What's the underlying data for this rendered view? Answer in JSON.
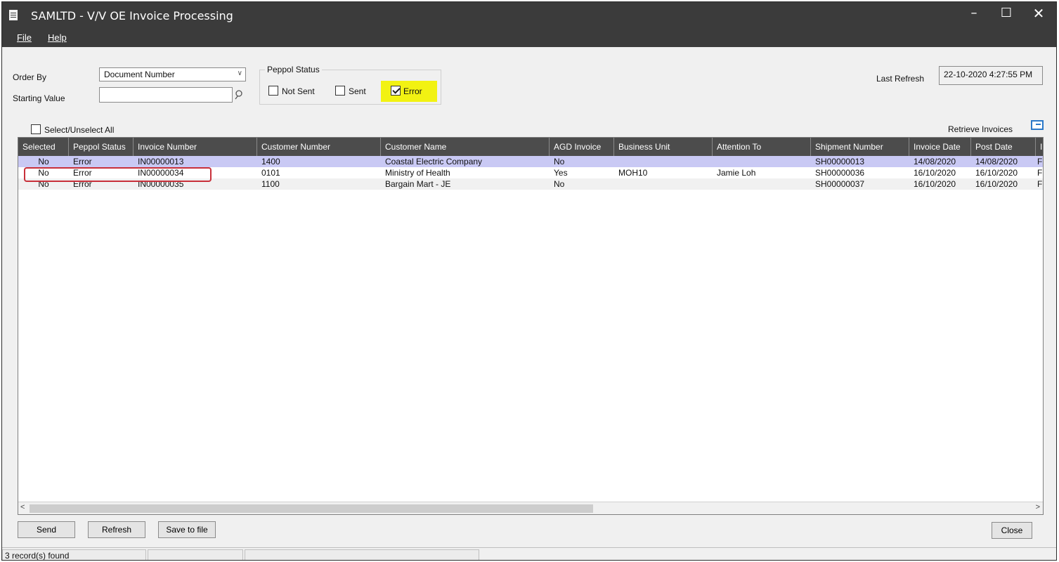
{
  "window": {
    "title": "SAMLTD - V/V OE Invoice Processing",
    "min_glyph": "–",
    "max_glyph": "☐",
    "close_glyph": "✕"
  },
  "menu": {
    "file": "File",
    "help": "Help"
  },
  "filters": {
    "order_by_label": "Order By",
    "order_by_value": "Document Number",
    "starting_value_label": "Starting Value",
    "starting_value": "",
    "peppol_status_title": "Peppol Status",
    "not_sent_label": "Not Sent",
    "not_sent_checked": false,
    "sent_label": "Sent",
    "sent_checked": false,
    "error_label": "Error",
    "error_checked": true,
    "highlight_color": "#f2f212"
  },
  "refresh": {
    "label": "Last Refresh",
    "value": "22-10-2020 4:27:55 PM"
  },
  "select_all_label": "Select/Unselect All",
  "retrieve_label": "Retrieve Invoices",
  "table": {
    "columns": [
      "Selected",
      "Peppol Status",
      "Invoice Number",
      "Customer Number",
      "Customer Name",
      "AGD Invoice",
      "Business Unit",
      "Attention To",
      "Shipment Number",
      "Invoice Date",
      "Post Date",
      "I"
    ],
    "rows": [
      [
        "No",
        "Error",
        "IN00000013",
        "1400",
        "Coastal Electric Company",
        "No",
        "",
        "",
        "SH00000013",
        "14/08/2020",
        "14/08/2020",
        "F"
      ],
      [
        "No",
        "Error",
        "IN00000034",
        "0101",
        "Ministry of Health",
        "Yes",
        "MOH10",
        "Jamie Loh",
        "SH00000036",
        "16/10/2020",
        "16/10/2020",
        "F"
      ],
      [
        "No",
        "Error",
        "IN00000035",
        "1100",
        "Bargain Mart - JE",
        "No",
        "",
        "",
        "SH00000037",
        "16/10/2020",
        "16/10/2020",
        "F"
      ]
    ],
    "selected_row_color": "#c9c9f4",
    "header_color": "#4c4c4c"
  },
  "buttons": {
    "send": "Send",
    "refresh": "Refresh",
    "save": "Save to file",
    "close": "Close"
  },
  "status": {
    "records": "3 record(s) found"
  }
}
